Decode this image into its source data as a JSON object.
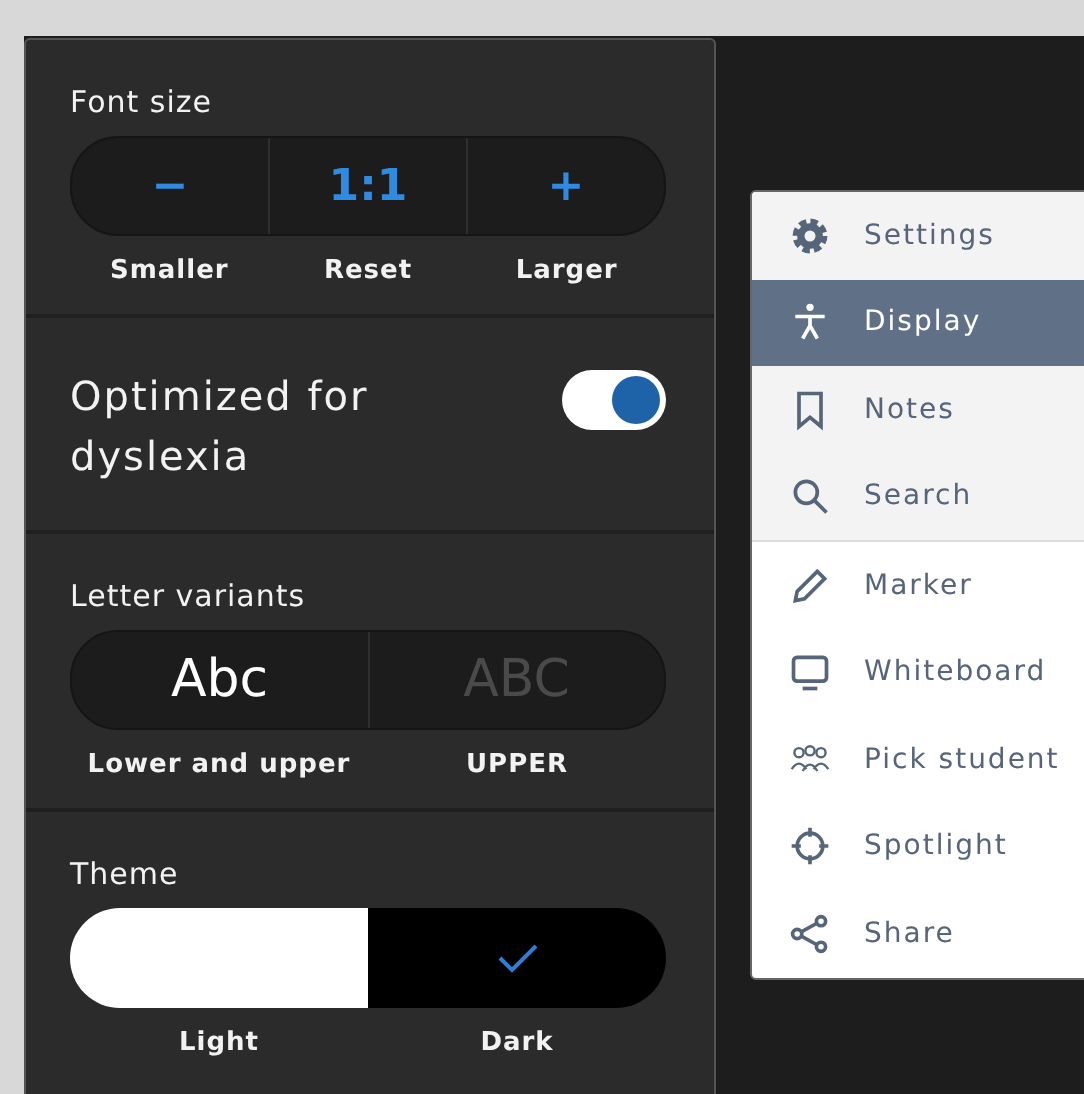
{
  "font_size": {
    "title": "Font size",
    "buttons": [
      {
        "symbol": "−",
        "label": "Smaller"
      },
      {
        "symbol": "1:1",
        "label": "Reset"
      },
      {
        "symbol": "+",
        "label": "Larger"
      }
    ]
  },
  "dyslexia": {
    "label": "Optimized for dyslexia",
    "on": true
  },
  "letter_variants": {
    "title": "Letter variants",
    "options": [
      {
        "sample": "Abc",
        "label": "Lower and upper",
        "selected": true
      },
      {
        "sample": "ABC",
        "label": "UPPER",
        "selected": false
      }
    ]
  },
  "theme": {
    "title": "Theme",
    "options": [
      {
        "kind": "light",
        "label": "Light",
        "selected": false
      },
      {
        "kind": "dark",
        "label": "Dark",
        "selected": true
      }
    ]
  },
  "menu": {
    "groups": [
      [
        {
          "label": "Settings",
          "selected": false
        },
        {
          "label": "Display",
          "selected": true
        },
        {
          "label": "Notes",
          "selected": false
        },
        {
          "label": "Search",
          "selected": false
        }
      ],
      [
        {
          "label": "Marker",
          "selected": false
        },
        {
          "label": "Whiteboard",
          "selected": false
        },
        {
          "label": "Pick student",
          "selected": false
        },
        {
          "label": "Spotlight",
          "selected": false
        },
        {
          "label": "Share",
          "selected": false
        }
      ]
    ]
  }
}
